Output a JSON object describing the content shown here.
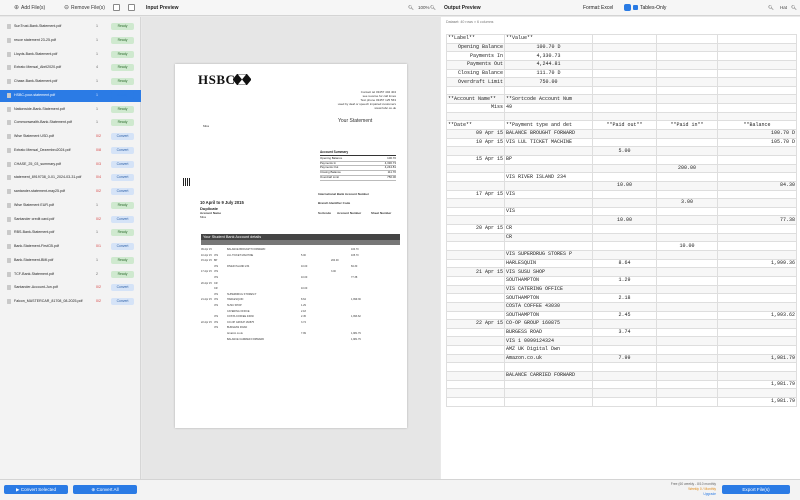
{
  "toolbar": {
    "add_files": "Add File(s)",
    "remove_files": "Remove File(s)",
    "input_preview": "Input Preview",
    "input_zoom": "100%",
    "output_preview": "Output Preview",
    "format_label": "Format:",
    "format_value": "Excel",
    "tables_only": "Tables-Only",
    "output_zoom": "Hat"
  },
  "files": [
    {
      "name": "SunTrust-Bank-Statement.pdf",
      "pages": "1",
      "status": "Ready",
      "selected": false,
      "error": false
    },
    {
      "name": "reuce statement 23-25.pdf",
      "pages": "1",
      "status": "Ready",
      "selected": false,
      "error": false
    },
    {
      "name": "Lloyds-Bank-Statement.pdf",
      "pages": "1",
      "status": "Ready",
      "selected": false,
      "error": false
    },
    {
      "name": "Extrato Mensal_Abril2020.pdf",
      "pages": "4",
      "status": "Ready",
      "selected": false,
      "error": false
    },
    {
      "name": "Chase-Bank-Statement.pdf",
      "pages": "1",
      "status": "Ready",
      "selected": false,
      "error": false
    },
    {
      "name": "HSBC-your-statement.pdf",
      "pages": "1",
      "status": "Ready",
      "selected": true,
      "error": false
    },
    {
      "name": "Nationwide-Bank-Statement.pdf",
      "pages": "1",
      "status": "Ready",
      "selected": false,
      "error": false
    },
    {
      "name": "Commonwealth-Bank-Statement.pdf",
      "pages": "1",
      "status": "Ready",
      "selected": false,
      "error": false
    },
    {
      "name": "Wise Statement USD.pdf",
      "pages": "0/2",
      "status": "Convert",
      "selected": false,
      "error": true
    },
    {
      "name": "Extrato Mensal_Dezembro2024.pdf",
      "pages": "0/8",
      "status": "Convert",
      "selected": false,
      "error": true
    },
    {
      "name": "CHASE_25_03_summary.pdf",
      "pages": "0/3",
      "status": "Convert",
      "selected": false,
      "error": true
    },
    {
      "name": "statement_8919738_0-01_2024-03-31.pdf",
      "pages": "0/4",
      "status": "Convert",
      "selected": false,
      "error": true
    },
    {
      "name": "santander-statement-may25.pdf",
      "pages": "0/2",
      "status": "Convert",
      "selected": false,
      "error": true
    },
    {
      "name": "Wise Statement EUR.pdf",
      "pages": "1",
      "status": "Ready",
      "selected": false,
      "error": false
    },
    {
      "name": "Santander credit card.pdf",
      "pages": "0/2",
      "status": "Convert",
      "selected": false,
      "error": true
    },
    {
      "name": "RBS-Bank-Statement.pdf",
      "pages": "1",
      "status": "Ready",
      "selected": false,
      "error": false
    },
    {
      "name": "Bank-Statement-FirstCB.pdf",
      "pages": "0/1",
      "status": "Convert",
      "selected": false,
      "error": true
    },
    {
      "name": "Bank-Statement-BMI.pdf",
      "pages": "1",
      "status": "Ready",
      "selected": false,
      "error": false
    },
    {
      "name": "TCF-Bank-Statement.pdf",
      "pages": "2",
      "status": "Ready",
      "selected": false,
      "error": false
    },
    {
      "name": "Santander-Account-Jun.pdf",
      "pages": "0/2",
      "status": "Convert",
      "selected": false,
      "error": true
    },
    {
      "name": "Falcon_MASTERCAR_81708_08-2025.pdf",
      "pages": "0/2",
      "status": "Convert",
      "selected": false,
      "error": true
    }
  ],
  "bottom": {
    "convert_selected": "Convert Selected",
    "convert_all": "Convert All",
    "plan_line1": "Free (60 weekly - 8/10 monthly",
    "plan_line2": "Weekly 0 / Monthly",
    "plan_upgrade": "Upgrade",
    "export": "Export File(s)"
  },
  "doc": {
    "bank": "HSBC",
    "contact_lines": [
      "Contact tel 03457 404 404",
      "see reverse for call times",
      "Text phone 03457 125 563",
      "used by deaf or speech impaired customers",
      "www.hsbc.co.uk"
    ],
    "your_statement": "Your Statement",
    "recipient": "Miss",
    "summary_title": "Account Summary",
    "summary": [
      {
        "label": "Opening Balance",
        "value": "100.70"
      },
      {
        "label": "Payments In",
        "value": "4,330.73"
      },
      {
        "label": "Payments Out",
        "value": "4,244.81"
      },
      {
        "label": "Closing Balance",
        "value": "111.70"
      },
      {
        "label": "Overdraft Limit",
        "value": "750.00"
      }
    ],
    "iban_label": "International Bank Account Number",
    "bic_label": "Branch Identifier Code",
    "sortcode_label": "Sortcode",
    "account_label": "Account Number",
    "sheet_label": "Sheet Number",
    "period": "10 April to 9 July 2015",
    "duplicate": "Duplicate",
    "account_name_label": "Account Name",
    "account_name": "Miss",
    "table_title": "Your Student Bank Account details",
    "tx": [
      {
        "d": "09 Apr 15",
        "t": "",
        "desc": "BALANCE BROUGHT FORWARD",
        "o": "",
        "i": "",
        "b": "100.70"
      },
      {
        "d": "10 Apr 15",
        "t": "VIS",
        "desc": "LUL TICKET MACHINE",
        "o": "5.00",
        "i": "",
        "b": "105.70"
      },
      {
        "d": "15 Apr 15",
        "t": "BP",
        "desc": "",
        "o": "",
        "i": "200.00",
        "b": ""
      },
      {
        "d": "",
        "t": "VIS",
        "desc": "RIVER ISLAND 234",
        "o": "10.00",
        "i": "",
        "b": "84.30"
      },
      {
        "d": "17 Apr 15",
        "t": "VIS",
        "desc": "",
        "o": "",
        "i": "3.00",
        "b": ""
      },
      {
        "d": "",
        "t": "VIS",
        "desc": "",
        "o": "10.00",
        "i": "",
        "b": "77.38"
      },
      {
        "d": "20 Apr 15",
        "t": "CR",
        "desc": "",
        "o": "",
        "i": "",
        "b": ""
      },
      {
        "d": "",
        "t": "CR",
        "desc": "",
        "o": "10.00",
        "i": "",
        "b": ""
      },
      {
        "d": "",
        "t": "VIS",
        "desc": "SUPERDRUG STORES P",
        "o": "",
        "i": "",
        "b": ""
      },
      {
        "d": "21 Apr 15",
        "t": "VIS",
        "desc": "HARLESQUIN",
        "o": "8.64",
        "i": "",
        "b": "1,999.36"
      },
      {
        "d": "",
        "t": "VIS",
        "desc": "SUSU SHOP",
        "o": "1.29",
        "i": "",
        "b": ""
      },
      {
        "d": "",
        "t": "",
        "desc": "CATERING OFFICE",
        "o": "2.18",
        "i": "",
        "b": ""
      },
      {
        "d": "",
        "t": "VIS",
        "desc": "COSTA COFFEE 43030",
        "o": "2.45",
        "i": "",
        "b": "1,993.62"
      },
      {
        "d": "22 Apr 15",
        "t": "VIS",
        "desc": "CO-OP GROUP 160875",
        "o": "3.74",
        "i": "",
        "b": ""
      },
      {
        "d": "",
        "t": "VIS",
        "desc": "BURGESS ROAD",
        "o": "",
        "i": "",
        "b": ""
      },
      {
        "d": "",
        "t": "",
        "desc": "Amazon.co.uk",
        "o": "7.99",
        "i": "",
        "b": "1,981.79"
      },
      {
        "d": "",
        "t": "",
        "desc": "BALANCE CARRIED FORWARD",
        "o": "",
        "i": "",
        "b": "1,981.79"
      }
    ]
  },
  "output": {
    "info": "Dataset: 40 rows × 6 columns",
    "rows": [
      [
        "**Label**",
        "**Value**",
        "",
        "",
        ""
      ],
      [
        "Opening Balance",
        "100.70 D",
        "",
        "",
        ""
      ],
      [
        "Payments In",
        "4,330.73",
        "",
        "",
        ""
      ],
      [
        "Payments Out",
        "4,244.81",
        "",
        "",
        ""
      ],
      [
        "Closing Balance",
        "111.70 D",
        "",
        "",
        ""
      ],
      [
        "Overdraft Limit",
        "750.00",
        "",
        "",
        ""
      ],
      [
        "",
        "",
        "",
        "",
        ""
      ],
      [
        "**Account Name**",
        "**Sortcode Account Num",
        "",
        "",
        ""
      ],
      [
        "Miss",
        "49",
        "",
        "",
        ""
      ],
      [
        "",
        "",
        "",
        "",
        ""
      ],
      [
        "**Date**",
        "**Payment type and det",
        "**Paid out**",
        "**Paid in**",
        "**Balance"
      ],
      [
        "09 Apr 15",
        "BALANCE BROUGHT FORWARD",
        "",
        "",
        "100.70 D"
      ],
      [
        "10 Apr 15",
        "VIS LUL TICKET MACHINE",
        "",
        "",
        "105.70 D"
      ],
      [
        "",
        "",
        "5.00",
        "",
        ""
      ],
      [
        "15 Apr 15",
        "BP",
        "",
        "",
        ""
      ],
      [
        "",
        "",
        "",
        "200.00",
        ""
      ],
      [
        "",
        "VIS RIVER ISLAND 234",
        "",
        "",
        ""
      ],
      [
        "",
        "",
        "10.00",
        "",
        "84.30"
      ],
      [
        "17 Apr 15",
        "VIS",
        "",
        "",
        ""
      ],
      [
        "",
        "",
        "",
        "3.00",
        ""
      ],
      [
        "",
        "VIS",
        "",
        "",
        ""
      ],
      [
        "",
        "",
        "10.00",
        "",
        "77.38"
      ],
      [
        "20 Apr 15",
        "CR",
        "",
        "",
        ""
      ],
      [
        "",
        "CR",
        "",
        "",
        ""
      ],
      [
        "",
        "",
        "",
        "10.00",
        ""
      ],
      [
        "",
        "VIS SUPERDRUG STORES P",
        "",
        "",
        ""
      ],
      [
        "",
        "HARLESQUIN",
        "8.64",
        "",
        "1,999.36"
      ],
      [
        "21 Apr 15",
        "VIS SUSU SHOP",
        "",
        "",
        ""
      ],
      [
        "",
        "SOUTHAMPTON",
        "1.29",
        "",
        ""
      ],
      [
        "",
        "VIS CATERING OFFICE",
        "",
        "",
        ""
      ],
      [
        "",
        "SOUTHAMPTON",
        "2.18",
        "",
        ""
      ],
      [
        "",
        "COSTA COFFEE 43030",
        "",
        "",
        ""
      ],
      [
        "",
        "SOUTHAMPTON",
        "2.45",
        "",
        "1,993.62"
      ],
      [
        "22 Apr 15",
        "CO-OP GROUP 160875",
        "",
        "",
        ""
      ],
      [
        "",
        "BURGESS ROAD",
        "3.74",
        "",
        ""
      ],
      [
        "",
        "VIS 1 0099124324",
        "",
        "",
        ""
      ],
      [
        "",
        "AMZ UK Digital Dwn",
        "",
        "",
        ""
      ],
      [
        "",
        "Amazon.co.uk",
        "7.99",
        "",
        "1,981.79"
      ],
      [
        "",
        "",
        "",
        "",
        ""
      ],
      [
        "",
        "BALANCE CARRIED FORWARD",
        "",
        "",
        ""
      ],
      [
        "",
        "",
        "",
        "",
        "1,981.79"
      ],
      [
        "",
        "",
        "",
        "",
        ""
      ],
      [
        "",
        "",
        "",
        "",
        "1,981.79"
      ]
    ]
  }
}
